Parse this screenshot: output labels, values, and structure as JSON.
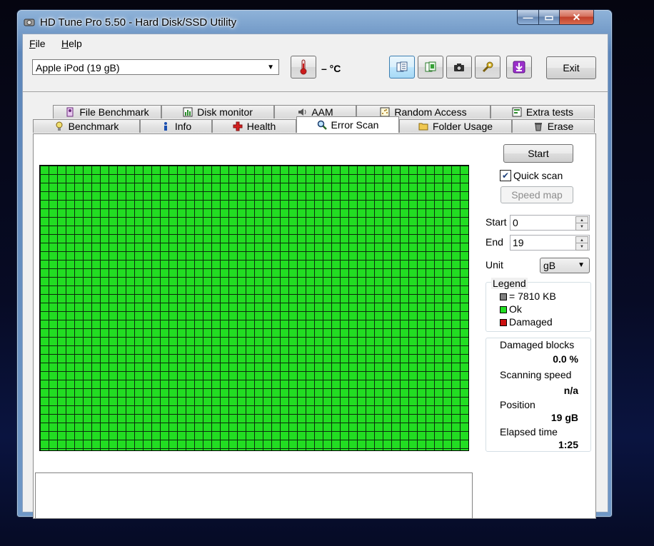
{
  "window": {
    "title": "HD Tune Pro 5.50 - Hard Disk/SSD Utility",
    "controls": {
      "minimize": "—",
      "maximize": "▭",
      "close": "✕"
    }
  },
  "menu": {
    "file": "File",
    "help": "Help"
  },
  "toolbar": {
    "drive": "Apple   iPod (19 gB)",
    "temperature": "– °C",
    "exit_label": "Exit",
    "icons": [
      "thermometer-icon",
      "copy-text-icon",
      "copy-info-icon",
      "screenshot-icon",
      "options-icon",
      "save-icon"
    ]
  },
  "tabs": {
    "row1": [
      "File Benchmark",
      "Disk monitor",
      "AAM",
      "Random Access",
      "Extra tests"
    ],
    "row2": [
      "Benchmark",
      "Info",
      "Health",
      "Error Scan",
      "Folder Usage",
      "Erase"
    ],
    "selected": "Error Scan"
  },
  "scan": {
    "start_button": "Start",
    "quick_scan_label": "Quick scan",
    "quick_scan_checked": true,
    "speed_map_button": "Speed map",
    "start_label": "Start",
    "start_value": "0",
    "end_label": "End",
    "end_value": "19",
    "unit_label": "Unit",
    "unit_value": "gB"
  },
  "legend": {
    "title": "Legend",
    "block_size": "= 7810 KB",
    "ok": "Ok",
    "damaged": "Damaged",
    "colors": {
      "block": "#808080",
      "ok": "#22dd22",
      "damaged": "#cc1111"
    }
  },
  "stats": {
    "damaged_blocks_label": "Damaged blocks",
    "damaged_blocks_value": "0.0 %",
    "scanning_speed_label": "Scanning speed",
    "scanning_speed_value": "n/a",
    "position_label": "Position",
    "position_value": "19 gB",
    "elapsed_label": "Elapsed time",
    "elapsed_value": "1:25"
  }
}
